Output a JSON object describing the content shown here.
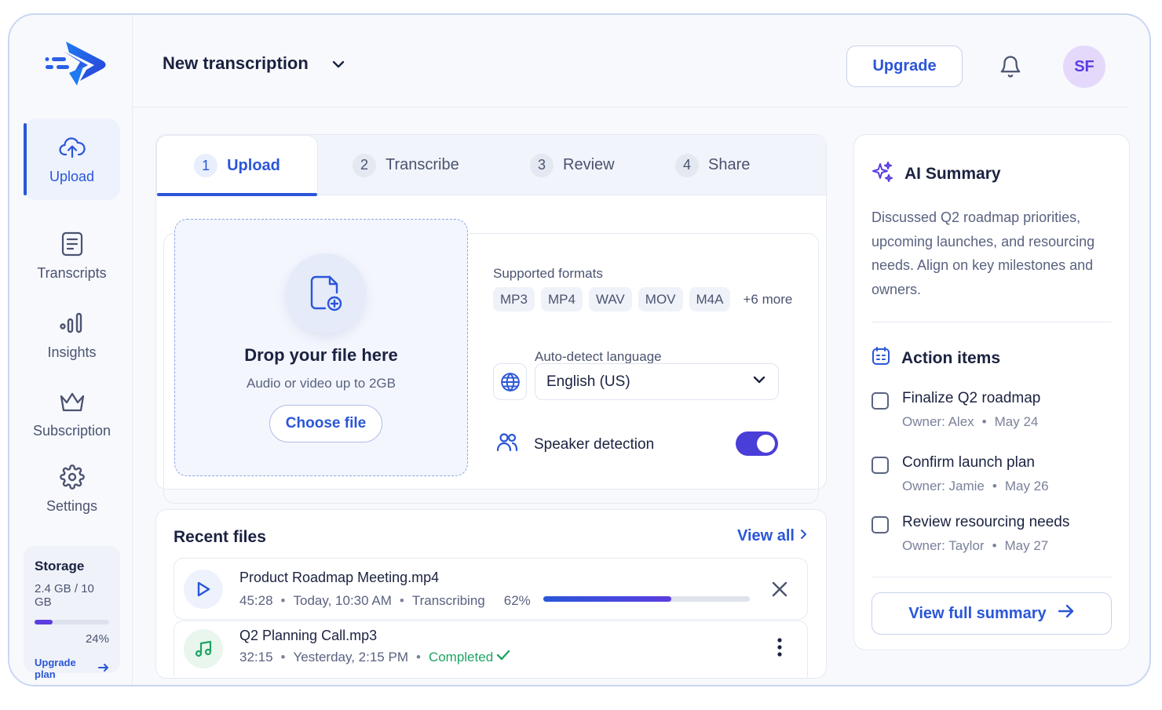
{
  "header": {
    "title": "New transcription",
    "upgrade_label": "Upgrade",
    "avatar_initials": "SF"
  },
  "sidebar": {
    "items": [
      {
        "label": "Upload",
        "icon": "cloud-upload-icon",
        "active": true
      },
      {
        "label": "Transcripts",
        "icon": "document-icon"
      },
      {
        "label": "Insights",
        "icon": "bar-chart-icon"
      },
      {
        "label": "Subscription",
        "icon": "crown-icon"
      },
      {
        "label": "Settings",
        "icon": "gear-icon"
      }
    ],
    "storage": {
      "title": "Storage",
      "used": "2.4 GB / 10 GB",
      "percent_label": "24%",
      "percent": 24,
      "upgrade_link": "Upgrade plan"
    }
  },
  "steps": [
    {
      "num": "1",
      "label": "Upload",
      "active": true
    },
    {
      "num": "2",
      "label": "Transcribe"
    },
    {
      "num": "3",
      "label": "Review"
    },
    {
      "num": "4",
      "label": "Share"
    }
  ],
  "dropzone": {
    "title": "Drop your file here",
    "subtitle": "Audio or video up to 2GB",
    "button": "Choose file"
  },
  "formats": {
    "label": "Supported formats",
    "chips": [
      "MP3",
      "MP4",
      "WAV",
      "MOV",
      "M4A"
    ],
    "more": "+6 more"
  },
  "language": {
    "label": "Auto-detect language",
    "value": "English (US)"
  },
  "speaker": {
    "label": "Speaker detection",
    "enabled": true
  },
  "recent": {
    "title": "Recent files",
    "view_all": "View all",
    "files": [
      {
        "name": "Product Roadmap Meeting.mp4",
        "duration": "45:28",
        "date": "Today, 10:30 AM",
        "status": "Transcribing",
        "progress_label": "62%",
        "progress": 62,
        "icon": "play-icon"
      },
      {
        "name": "Q2 Planning Call.mp3",
        "duration": "32:15",
        "date": "Yesterday, 2:15 PM",
        "status": "Completed",
        "icon": "music-note-icon"
      }
    ]
  },
  "summary": {
    "title": "AI Summary",
    "text": "Discussed Q2 roadmap priorities, upcoming launches, and resourcing needs. Align on key milestones and owners.",
    "action_title": "Action items",
    "items": [
      {
        "label": "Finalize Q2 roadmap",
        "owner": "Owner: Alex",
        "date": "May 24"
      },
      {
        "label": "Confirm launch plan",
        "owner": "Owner: Jamie",
        "date": "May 26"
      },
      {
        "label": "Review resourcing needs",
        "owner": "Owner: Taylor",
        "date": "May 27"
      }
    ],
    "button": "View full summary"
  },
  "colors": {
    "accent": "#2a56d8",
    "violet": "#5b3de0",
    "success": "#1fa463"
  }
}
